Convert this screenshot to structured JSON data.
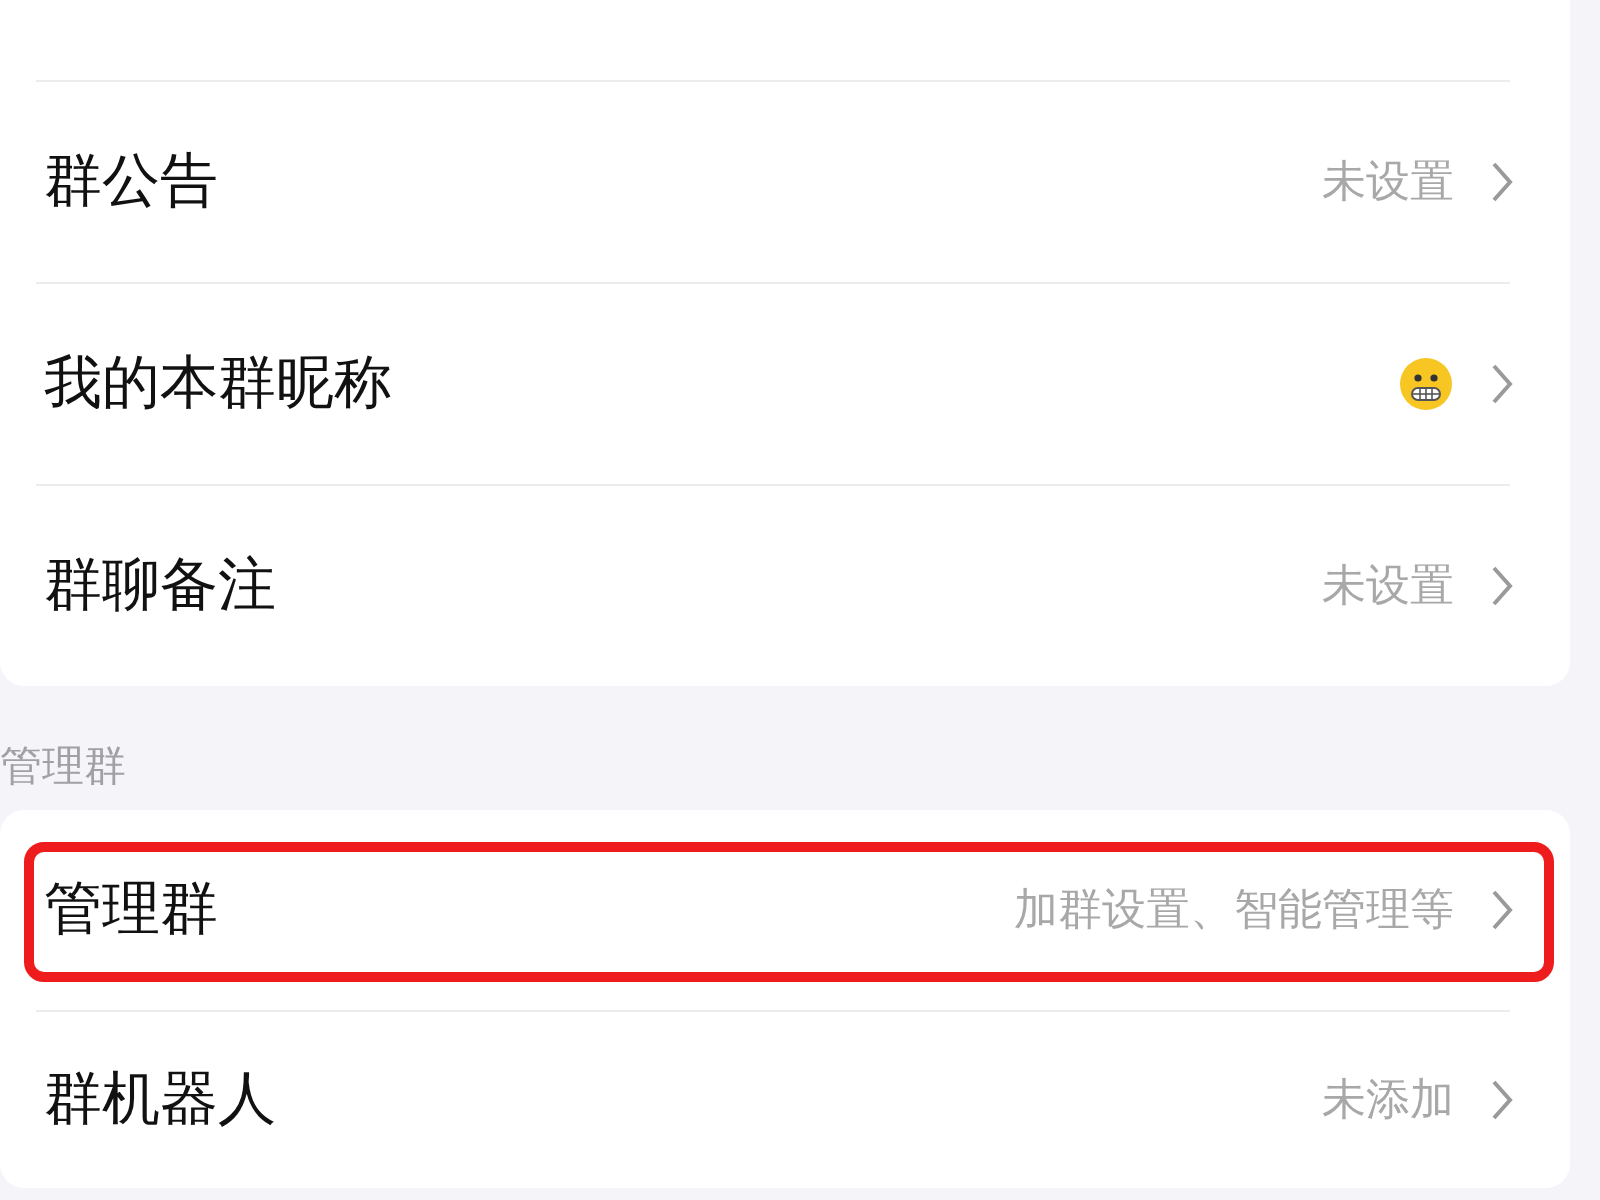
{
  "groups": [
    {
      "items": [
        {
          "kind": "text",
          "label": "群公告",
          "value": "未设置",
          "highlighted": false
        },
        {
          "kind": "emoji",
          "label": "我的本群昵称",
          "highlighted": false
        },
        {
          "kind": "text",
          "label": "群聊备注",
          "value": "未设置",
          "highlighted": false
        }
      ]
    },
    {
      "header": "管理群",
      "items": [
        {
          "kind": "text",
          "label": "管理群",
          "value": "加群设置、智能管理等",
          "highlighted": true
        },
        {
          "kind": "text",
          "label": "群机器人",
          "value": "未添加",
          "highlighted": false
        }
      ]
    }
  ]
}
